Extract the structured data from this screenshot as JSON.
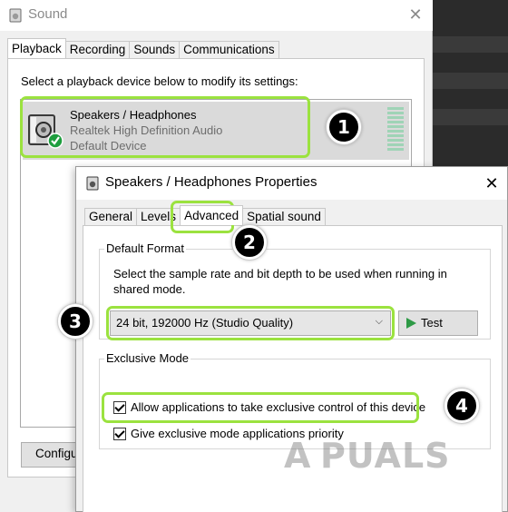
{
  "sound_window": {
    "title": "Sound",
    "close_glyph": "✕",
    "tabs": [
      "Playback",
      "Recording",
      "Sounds",
      "Communications"
    ],
    "active_tab": "Playback",
    "prompt": "Select a playback device below to modify its settings:",
    "device": {
      "name": "Speakers / Headphones",
      "driver": "Realtek High Definition Audio",
      "status": "Default Device",
      "icon": "speaker-icon",
      "status_icon": "checkmark-badge-icon"
    },
    "configure_label": "Configure"
  },
  "properties_dialog": {
    "title": "Speakers / Headphones Properties",
    "close_glyph": "✕",
    "tabs": [
      "General",
      "Levels",
      "Advanced",
      "Spatial sound"
    ],
    "active_tab": "Advanced",
    "default_format": {
      "legend": "Default Format",
      "description": "Select the sample rate and bit depth to be used when running in shared mode.",
      "selected": "24 bit, 192000 Hz (Studio Quality)",
      "test_label": "Test"
    },
    "exclusive_mode": {
      "legend": "Exclusive Mode",
      "allow_exclusive_label": "Allow applications to take exclusive control of this device",
      "allow_exclusive_checked": true,
      "priority_label": "Give exclusive mode applications priority",
      "priority_checked": true
    }
  },
  "annotations": {
    "badges": [
      "1",
      "2",
      "3",
      "4"
    ],
    "highlight_color": "#9be23f"
  },
  "watermark": {
    "text_left": "A",
    "text_right": "PUALS"
  },
  "colors": {
    "selection_bg": "#dadada",
    "test_play": "#2e9a46",
    "status_check": "#1e9e3e"
  }
}
